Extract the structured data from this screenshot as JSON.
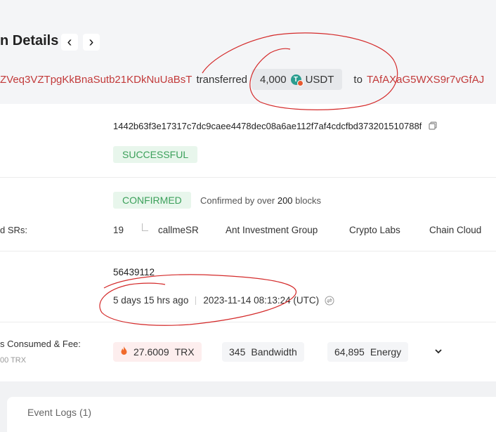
{
  "header": {
    "title": "n Details",
    "prev_arrow": "‹",
    "next_arrow": "›",
    "summary": {
      "from_address": "ZVeq3VZTpgKkBnaSutb21KDkNuUaBsT",
      "verb": "transferred",
      "amount": "4,000",
      "token": "USDT",
      "token_icon_letter": "T",
      "preposition": "to",
      "to_address": "TAfAXaG5WXS9r7vGfAJ"
    }
  },
  "details": {
    "hash": "1442b63f3e17317c7dc9caee4478dec08a6ae112f7af4cdcfbd373201510788f",
    "status": "SUCCESSFUL",
    "confirmation": {
      "badge": "CONFIRMED",
      "note_prefix": "Confirmed by over",
      "note_count": "200",
      "note_suffix": "blocks"
    },
    "sr_label": "d SRs:",
    "sr_count": "19",
    "srs": [
      "callmeSR",
      "Ant Investment Group",
      "Crypto Labs",
      "Chain Cloud"
    ],
    "block": "56439112",
    "time_ago": "5 days 15 hrs ago",
    "timestamp": "2023-11-14 08:13:24 (UTC)",
    "resources": {
      "label": "s Consumed & Fee:",
      "sublabel": "00 TRX",
      "trx_value": "27.6009",
      "trx_unit": "TRX",
      "bandwidth_value": "345",
      "bandwidth_unit": "Bandwidth",
      "energy_value": "64,895",
      "energy_unit": "Energy"
    }
  },
  "tabs": {
    "event_logs": "Event Logs (1)"
  },
  "colors": {
    "address": "#c23a3a",
    "success_bg": "#e8f6ec",
    "success_text": "#3ba05a",
    "annotation": "#d42a2a"
  }
}
